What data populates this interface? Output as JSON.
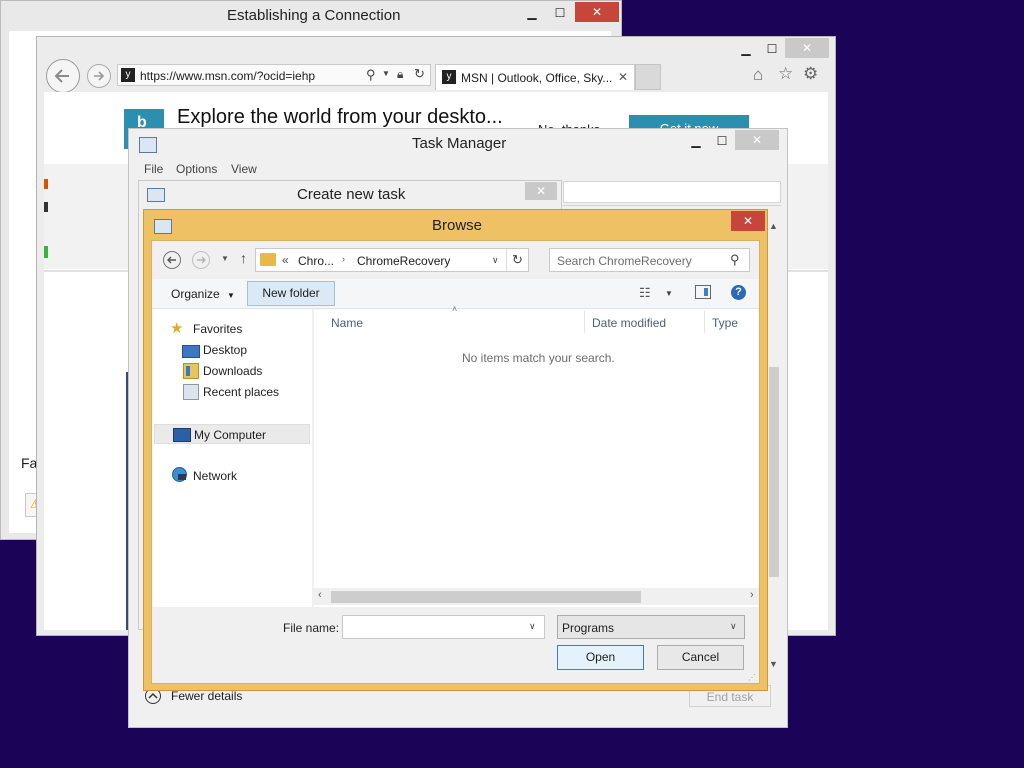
{
  "establish": {
    "title": "Establishing a Connection",
    "footer_text": "Fal"
  },
  "ie": {
    "address": "https://www.msn.com/?ocid=iehp",
    "tab_title": "MSN | Outlook, Office, Sky...",
    "banner_text": "Explore the world from your deskto...",
    "banner_no": "No, thanks",
    "banner_get": "Get it now"
  },
  "taskmgr": {
    "title": "Task Manager",
    "menu": [
      "File",
      "Options",
      "View"
    ],
    "fewer_details": "Fewer details",
    "end_task": "End task"
  },
  "create_task": {
    "title": "Create new task"
  },
  "browse": {
    "title": "Browse",
    "breadcrumb_prefix": "«",
    "breadcrumb_parent": "Chro...",
    "breadcrumb_current": "ChromeRecovery",
    "search_placeholder": "Search ChromeRecovery",
    "organize": "Organize",
    "new_folder": "New folder",
    "nav": {
      "favorites": "Favorites",
      "desktop": "Desktop",
      "downloads": "Downloads",
      "recent": "Recent places",
      "computer": "My Computer",
      "network": "Network"
    },
    "columns": {
      "name": "Name",
      "date": "Date modified",
      "type": "Type"
    },
    "empty_message": "No items match your search.",
    "file_name_label": "File name:",
    "file_name_value": "",
    "filter": "Programs",
    "open": "Open",
    "cancel": "Cancel"
  },
  "colors": {
    "desktop": "#1b0457",
    "close_red": "#c7463c",
    "browse_frame": "#eec264",
    "accent": "#2d8fb0"
  }
}
